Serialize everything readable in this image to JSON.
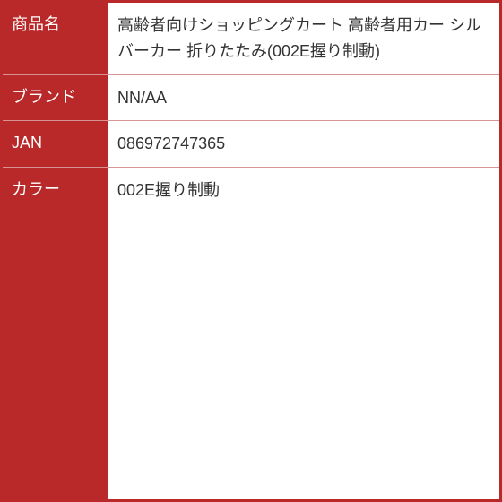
{
  "rows": [
    {
      "label": "商品名",
      "value": "高齢者向けショッピングカート 高齢者用カー シルバーカー 折りたたみ(002E握り制動)"
    },
    {
      "label": "ブランド",
      "value": "NN/AA"
    },
    {
      "label": "JAN",
      "value": "086972747365"
    },
    {
      "label": "カラー",
      "value": "002E握り制動"
    }
  ]
}
